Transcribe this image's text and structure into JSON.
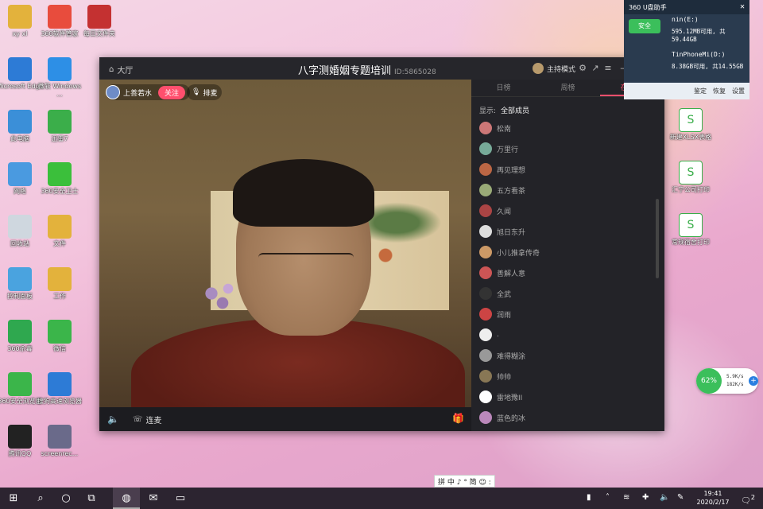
{
  "desktop_icons_left": [
    {
      "label": "xy xl",
      "icon": "folder-user-icon",
      "color": "#e3b23c"
    },
    {
      "label": "360软件管家",
      "icon": "app-grid-icon",
      "color": "#e84c3d"
    },
    {
      "label": "每日文件夹",
      "icon": "folder-icon",
      "color": "#c43131"
    },
    {
      "label": "Microsoft Edge",
      "icon": "edge-icon",
      "color": "#2d7bd6"
    },
    {
      "label": "微软 Windows ...",
      "icon": "windows-icon",
      "color": "#2d8fe6"
    },
    {
      "label": "此电脑",
      "icon": "computer-icon",
      "color": "#3b8fd8"
    },
    {
      "label": "迅雷7",
      "icon": "badge-icon",
      "color": "#3bae4a"
    },
    {
      "label": "网络",
      "icon": "network-icon",
      "color": "#4a9ae0"
    },
    {
      "label": "360安全卫士",
      "icon": "shield-plus-icon",
      "color": "#3bbf3b"
    },
    {
      "label": "回收站",
      "icon": "recycle-bin-icon",
      "color": "#cfd7df"
    },
    {
      "label": "文件",
      "icon": "folder-icon",
      "color": "#e3b23c"
    },
    {
      "label": "控制面板",
      "icon": "control-panel-icon",
      "color": "#4aa3df"
    },
    {
      "label": "工作",
      "icon": "folder-icon",
      "color": "#e3b23c"
    },
    {
      "label": "360杀毒",
      "icon": "shield-icon",
      "color": "#2fa84f"
    },
    {
      "label": "微信",
      "icon": "wechat-icon",
      "color": "#3bb54a"
    },
    {
      "label": "360安全浏览器",
      "icon": "ie-browser-icon",
      "color": "#3bb54a"
    },
    {
      "label": "搜狗高速浏览器",
      "icon": "sogou-icon",
      "color": "#2d7bd6"
    },
    {
      "label": "腾讯QQ",
      "icon": "qq-icon",
      "color": "#222222"
    },
    {
      "label": "screenrec...",
      "icon": "installer-icon",
      "color": "#6a6a8a"
    }
  ],
  "desktop_icons_right": [
    {
      "label": "新建XLSX表格",
      "icon": "spreadsheet-icon"
    },
    {
      "label": "汇宁公司打印",
      "icon": "spreadsheet-icon"
    },
    {
      "label": "常规宿舍打印",
      "icon": "spreadsheet-icon"
    }
  ],
  "window": {
    "home_label": "大厅",
    "title": "八字测婚姻专题培训",
    "room_id": "ID:5865028",
    "host_mode": "主持模式",
    "speaker_name": "上善若水",
    "follow_label": "关注",
    "queue_label": "排麦",
    "connect_label": "连麦"
  },
  "panel": {
    "tabs": [
      "日榜",
      "周榜",
      "在线65"
    ],
    "active_tab": 2,
    "filter_label": "显示:",
    "filter_value": "全部成员",
    "members": [
      {
        "name": "松南",
        "color": "#c77"
      },
      {
        "name": "万里行",
        "color": "#7a9"
      },
      {
        "name": "再见理想",
        "color": "#b64"
      },
      {
        "name": "五方看茶",
        "color": "#9a7"
      },
      {
        "name": "久闻",
        "color": "#a44"
      },
      {
        "name": "旭日东升",
        "color": "#ddd"
      },
      {
        "name": "小儿推拿传奇",
        "color": "#c96"
      },
      {
        "name": "善解人意",
        "color": "#c55"
      },
      {
        "name": "全武",
        "color": "#333"
      },
      {
        "name": "润雨",
        "color": "#c44"
      },
      {
        "name": ".",
        "color": "#eee"
      },
      {
        "name": "难得糊涂",
        "color": "#999"
      },
      {
        "name": "帅帅",
        "color": "#875"
      },
      {
        "name": "雷地豫II",
        "color": "#fff"
      },
      {
        "name": "蓝色的冰",
        "color": "#b8b"
      }
    ]
  },
  "u360": {
    "title": "360 U盘助手",
    "safe_label": "安全",
    "drives": [
      {
        "name": "nin(E:)",
        "info": "595.12MB可用, 共59.44GB"
      },
      {
        "name": "TinPhoneMi(D:)",
        "info": "8.38GB可用, 共14.55GB"
      }
    ],
    "footer": [
      "鉴定",
      "恢复",
      "设置"
    ]
  },
  "net": {
    "percent": "62%",
    "up": "5.9K/s",
    "down": "182K/s"
  },
  "ime": "拼 中 ♪ ° 简 ☺ :",
  "taskbar": {
    "time": "19:41",
    "date": "2020/2/17",
    "notify_count": "2"
  }
}
